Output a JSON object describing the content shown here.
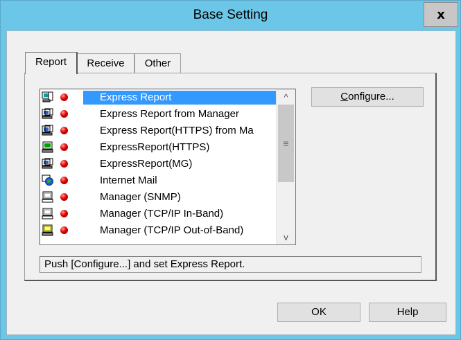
{
  "window": {
    "title": "Base Setting",
    "close_glyph": "x"
  },
  "tabs": [
    {
      "label": "Report",
      "active": true
    },
    {
      "label": "Receive",
      "active": false
    },
    {
      "label": "Other",
      "active": false
    }
  ],
  "report_list": {
    "items": [
      {
        "label": "Express Report",
        "icon": "network-computer-icon",
        "status": "red-dot-icon",
        "selected": true
      },
      {
        "label": "Express Report from Manager",
        "icon": "computer-icon",
        "status": "red-dot-icon"
      },
      {
        "label": "Express Report(HTTPS) from Ma",
        "icon": "computer-icon",
        "status": "red-dot-icon"
      },
      {
        "label": "ExpressReport(HTTPS)",
        "icon": "green-computer-icon",
        "status": "red-dot-icon"
      },
      {
        "label": "ExpressReport(MG)",
        "icon": "computer-icon",
        "status": "red-dot-icon"
      },
      {
        "label": "Internet Mail",
        "icon": "globe-computer-icon",
        "status": "red-dot-icon"
      },
      {
        "label": "Manager (SNMP)",
        "icon": "monitor-icon",
        "status": "red-dot-icon"
      },
      {
        "label": "Manager (TCP/IP In-Band)",
        "icon": "monitor-icon",
        "status": "red-dot-icon"
      },
      {
        "label": "Manager (TCP/IP Out-of-Band)",
        "icon": "yellow-monitor-icon",
        "status": "red-dot-icon"
      }
    ],
    "scroll_up_glyph": "^",
    "scroll_down_glyph": "v",
    "scroll_thumb_glyph": "≡"
  },
  "configure_button": {
    "label_prefix": "",
    "label_underlined": "C",
    "label_rest": "onfigure..."
  },
  "status_message": "Push [Configure...] and set Express Report.",
  "footer": {
    "ok_label": "OK",
    "help_label": "Help"
  },
  "colors": {
    "title_bar": "#6cc6e8",
    "selection": "#3399ff",
    "client": "#f0f0f0"
  }
}
